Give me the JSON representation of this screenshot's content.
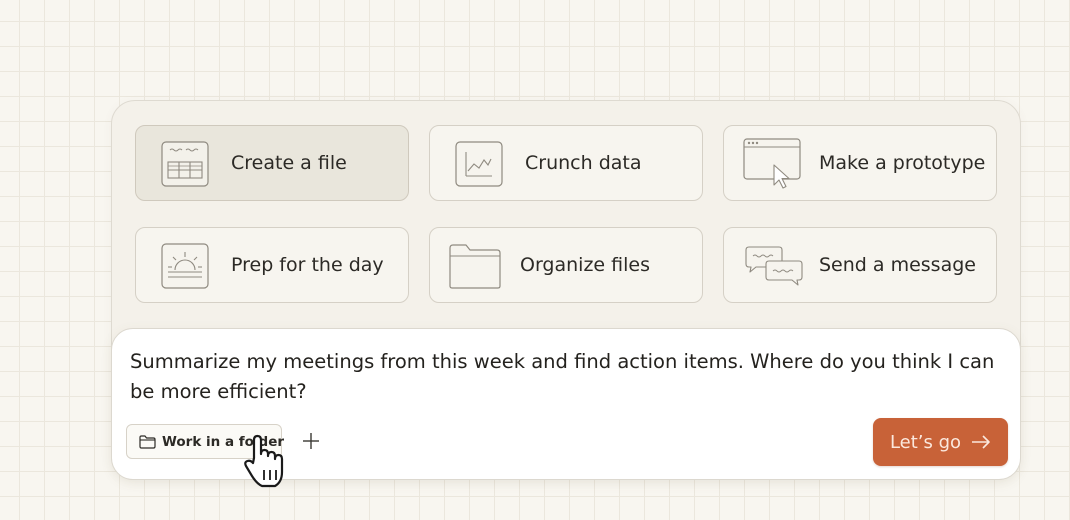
{
  "tiles": [
    {
      "label": "Create a file",
      "icon": "spreadsheet-icon",
      "selected": true
    },
    {
      "label": "Crunch data",
      "icon": "chart-icon",
      "selected": false
    },
    {
      "label": "Make a prototype",
      "icon": "browser-window-icon",
      "selected": false
    },
    {
      "label": "Prep for the day",
      "icon": "sunrise-icon",
      "selected": false
    },
    {
      "label": "Organize files",
      "icon": "folder-icon",
      "selected": false
    },
    {
      "label": "Send a message",
      "icon": "chat-bubbles-icon",
      "selected": false
    }
  ],
  "composer": {
    "prompt": "Summarize my meetings from this week and find action items. Where do you think I can be more efficient?",
    "folder_label": "Work in a folder",
    "submit_label": "Let’s go"
  },
  "colors": {
    "accent": "#c86238",
    "background": "#f8f6f0",
    "panel": "#f4f1ea",
    "selected_tile": "#e9e6dc"
  }
}
